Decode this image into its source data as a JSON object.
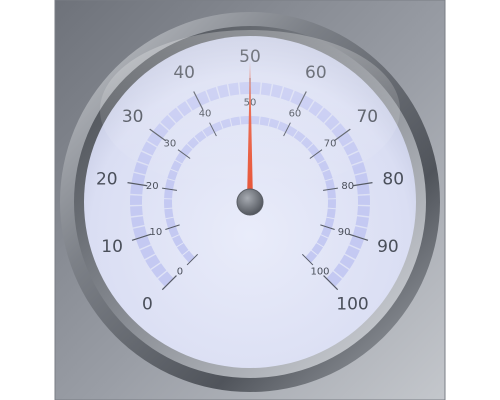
{
  "gauge": {
    "value": 50,
    "outer_scale": {
      "min": 0,
      "max": 100,
      "major_labels": [
        "0",
        "10",
        "20",
        "30",
        "40",
        "50",
        "60",
        "70",
        "80",
        "90",
        "100"
      ]
    },
    "inner_scale": {
      "min": 0,
      "max": 100,
      "major_labels": [
        "0",
        "10",
        "20",
        "30",
        "40",
        "50",
        "60",
        "70",
        "80",
        "90",
        "100"
      ]
    },
    "colors": {
      "panel": "#8c9098",
      "bezel": "#6f737a",
      "dial": "#dfe3f6",
      "scale_band": "#c4c9f2",
      "tick": "#555a66",
      "needle": "#e8573a",
      "hub": "#6a6e75"
    }
  }
}
